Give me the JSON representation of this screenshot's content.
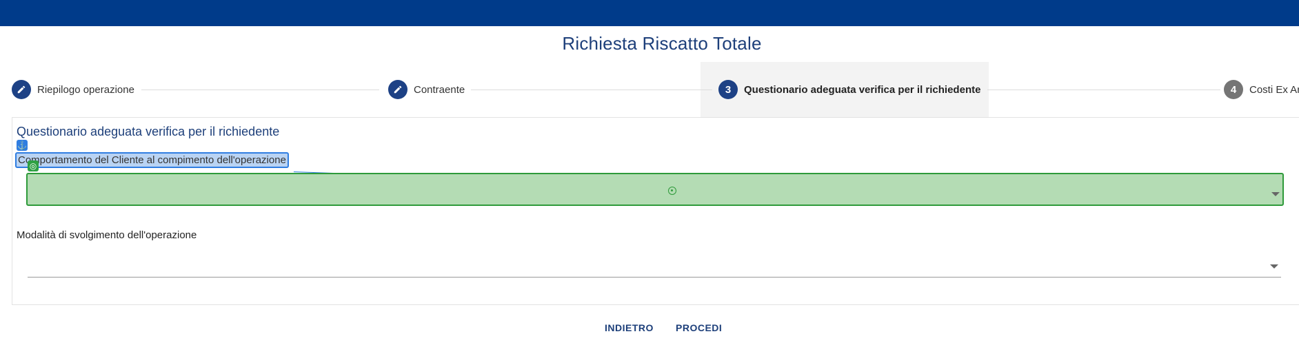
{
  "header": {
    "title": "Richiesta Riscatto Totale"
  },
  "stepper": {
    "steps": [
      {
        "label": "Riepilogo operazione",
        "marker": "pencil-icon",
        "state": "completed"
      },
      {
        "label": "Contraente",
        "marker": "pencil-icon",
        "state": "completed"
      },
      {
        "number": "3",
        "label": "Questionario adeguata verifica per il richiedente",
        "state": "active"
      },
      {
        "number": "4",
        "label": "Costi Ex Ar",
        "state": "pending"
      }
    ]
  },
  "form": {
    "section_title": "Questionario adeguata verifica per il richiedente",
    "fields": [
      {
        "label": "Comportamento del Cliente al compimento dell'operazione",
        "value": ""
      },
      {
        "label": "Modalità di svolgimento dell'operazione",
        "value": ""
      }
    ]
  },
  "actions": {
    "back_label": "INDIETRO",
    "proceed_label": "PROCEDI"
  },
  "colors": {
    "topbar": "#003b8a",
    "primary": "#1d4185",
    "highlight_blue": "#2f7de1",
    "highlight_green": "#2e9a3a"
  }
}
